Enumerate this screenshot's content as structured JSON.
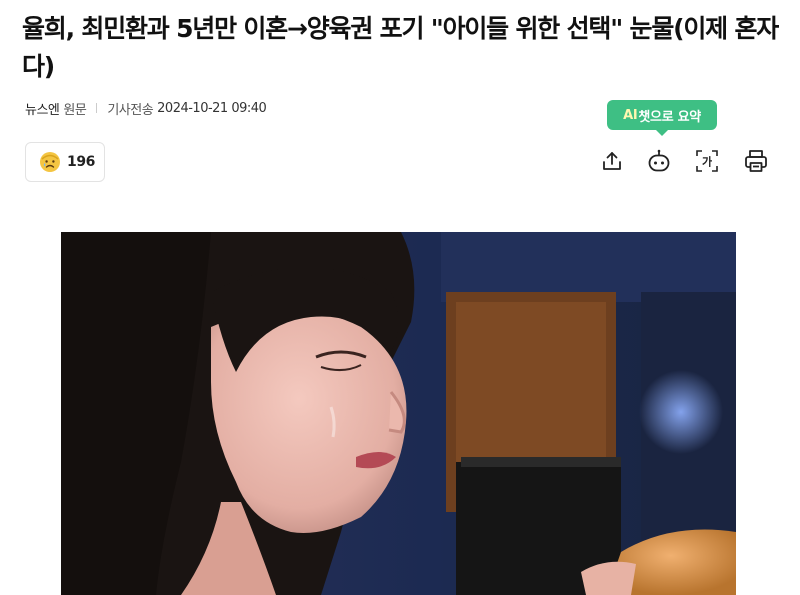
{
  "article": {
    "headline": "율희, 최민환과 5년만 이혼→양육권 포기 \"아이들 위한 선택\" 눈물(이제 혼자다)",
    "press": "뉴스엔",
    "origin_link": "원문",
    "date_label": "기사전송",
    "date": "2024-10-21 09:40"
  },
  "reaction": {
    "icon": "sad-face-emoji-icon",
    "count": "196"
  },
  "ai_summary": {
    "ai": "AI",
    "label": "챗으로 요약"
  },
  "toolbar": {
    "share_icon": "share-icon",
    "ai_chat_icon": "ai-bot-icon",
    "font_size_icon": "font-size-icon",
    "font_size_glyph": "가",
    "print_icon": "print-icon"
  },
  "colors": {
    "tooltip_green": "#3ebf84",
    "reaction_yellow": "#f4c542",
    "text_dark": "#111111",
    "text_gray": "#555555"
  }
}
